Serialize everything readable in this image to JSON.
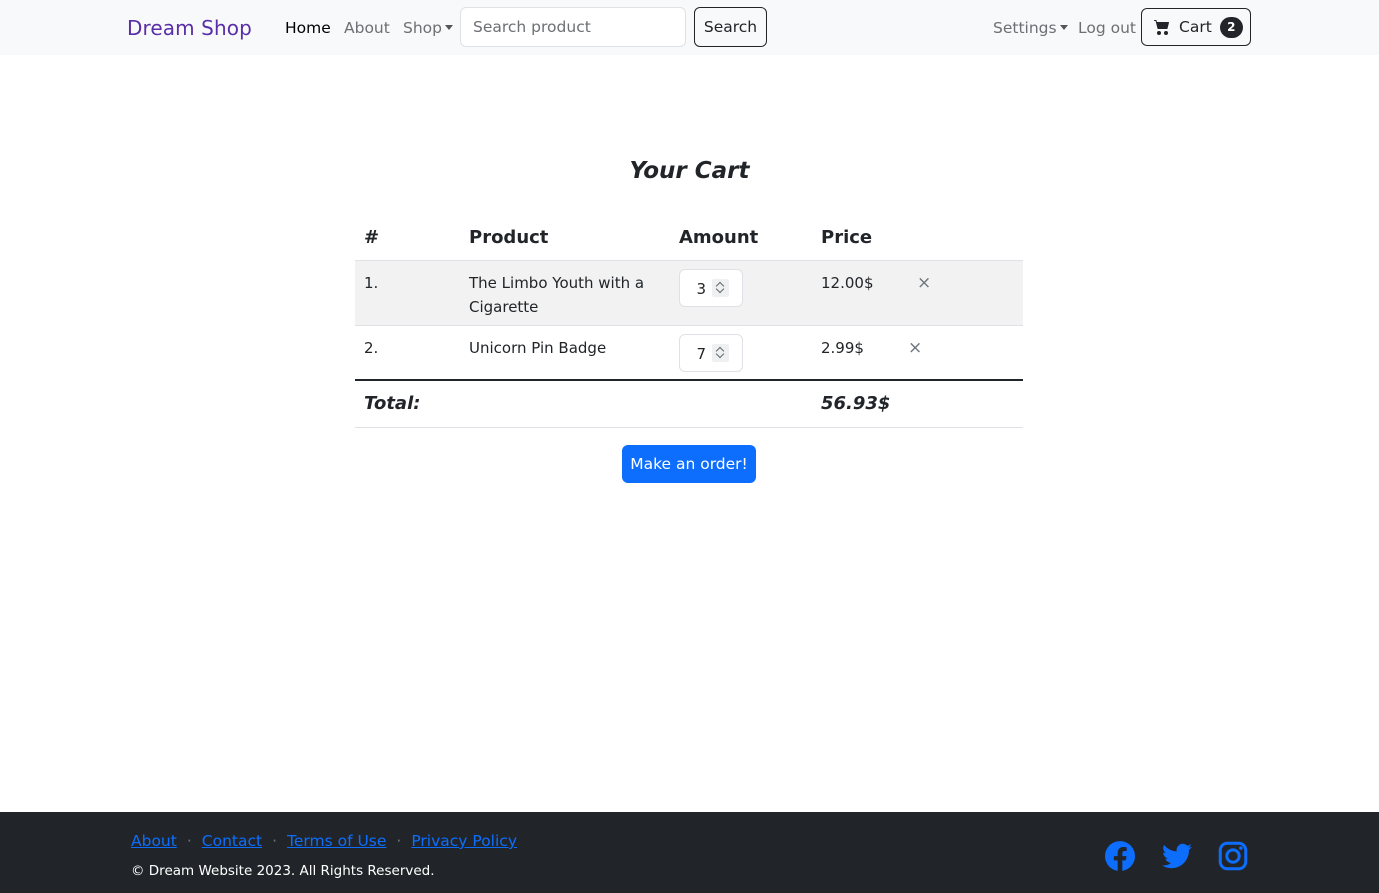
{
  "navbar": {
    "brand": "Dream Shop",
    "links": [
      {
        "label": "Home",
        "active": true
      },
      {
        "label": "About",
        "active": false
      },
      {
        "label": "Shop",
        "active": false
      }
    ],
    "search": {
      "placeholder": "Search product",
      "value": "",
      "button_label": "Search"
    },
    "settings_label": "Settings",
    "logout_label": "Log out",
    "cart": {
      "label": "Cart",
      "count": "2",
      "icon": "cart-icon"
    }
  },
  "main": {
    "title": "Your Cart",
    "table": {
      "headers": [
        "#",
        "Product",
        "Amount",
        "Price"
      ],
      "rows": [
        {
          "index": "1.",
          "product": "The Limbo Youth with a Cigarette",
          "amount": "3",
          "price": "12.00$",
          "remove": "×"
        },
        {
          "index": "2.",
          "product": "Unicorn Pin Badge",
          "amount": "7",
          "price": "2.99$",
          "remove": "×"
        }
      ],
      "total_label": "Total:",
      "total_value": "56.93$"
    },
    "order_button": "Make an order!"
  },
  "footer": {
    "links": [
      "About",
      "Contact",
      "Terms of Use",
      "Privacy Policy"
    ],
    "separator": "·",
    "copyright": "© Dream Website 2023. All Rights Reserved.",
    "social_icons": [
      "facebook-icon",
      "twitter-icon",
      "instagram-icon"
    ]
  },
  "colors": {
    "brand": "#5a2ea6",
    "primary": "#0d6efd",
    "dark": "#212529",
    "navbar_bg": "#f8f9fa"
  }
}
